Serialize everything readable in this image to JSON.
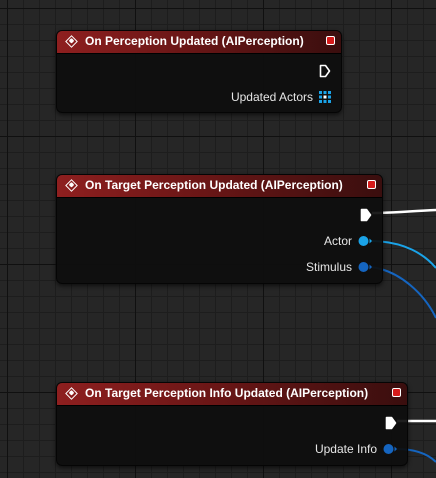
{
  "colors": {
    "header_red": "#8e1f1f",
    "exec_pin": "#ffffff",
    "object_pin": "#1aa3e8",
    "struct_pin": "#1565c0",
    "array_pin": "#1aa3e8"
  },
  "nodes": [
    {
      "title": "On Perception Updated (AIPerception)",
      "icon": "event-diamond-icon",
      "exec_pin_connected": false,
      "pins": [
        {
          "label": "Updated Actors",
          "icon": "array-grid-pin-icon"
        }
      ]
    },
    {
      "title": "On Target Perception Updated (AIPerception)",
      "icon": "event-diamond-icon",
      "exec_pin_connected": true,
      "pins": [
        {
          "label": "Actor",
          "icon": "object-pin-icon"
        },
        {
          "label": "Stimulus",
          "icon": "struct-pin-icon"
        }
      ]
    },
    {
      "title": "On Target Perception Info Updated (AIPerception)",
      "icon": "event-diamond-icon",
      "exec_pin_connected": true,
      "pins": [
        {
          "label": "Update Info",
          "icon": "struct-pin-icon"
        }
      ]
    }
  ]
}
